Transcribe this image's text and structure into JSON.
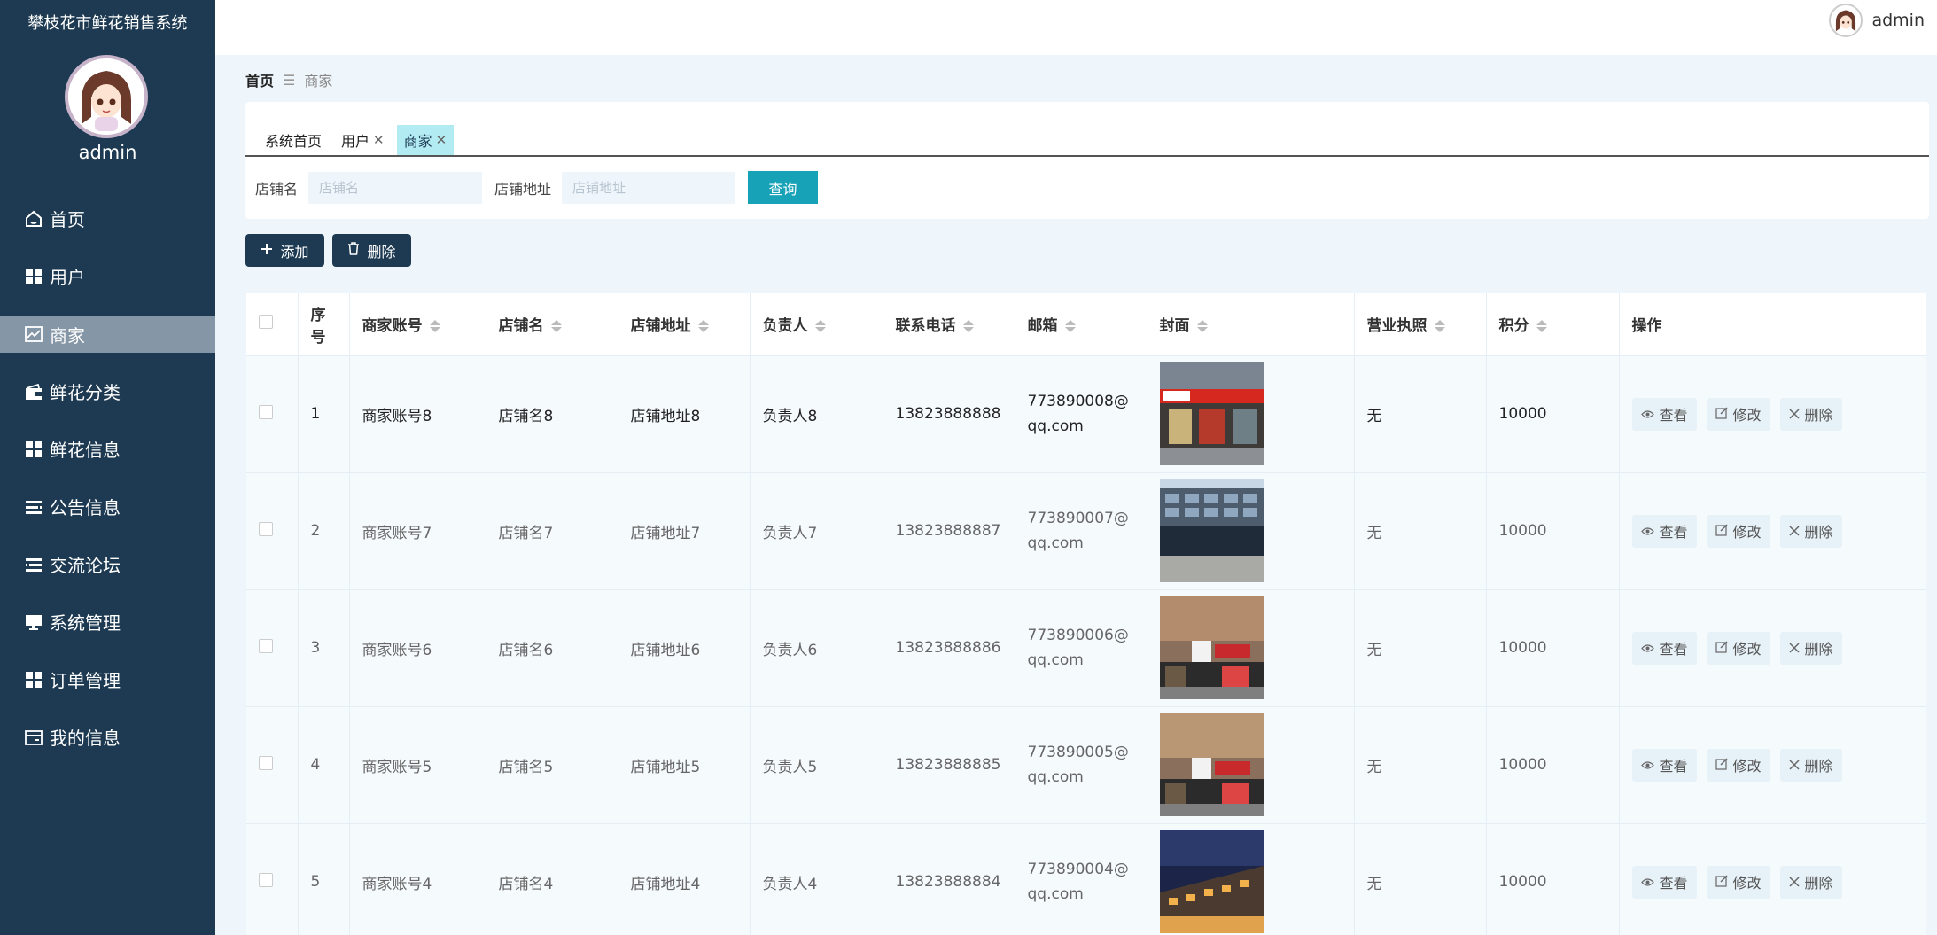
{
  "app": {
    "title": "攀枝花市鲜花销售系统",
    "admin_name": "admin"
  },
  "sidebar": {
    "items": [
      {
        "label": "首页",
        "icon": "home-icon"
      },
      {
        "label": "用户",
        "icon": "grid-icon"
      },
      {
        "label": "商家",
        "icon": "chart-icon",
        "active": true
      },
      {
        "label": "鲜花分类",
        "icon": "wallet-icon"
      },
      {
        "label": "鲜花信息",
        "icon": "grid-icon"
      },
      {
        "label": "公告信息",
        "icon": "list-icon"
      },
      {
        "label": "交流论坛",
        "icon": "list-icon"
      },
      {
        "label": "系统管理",
        "icon": "monitor-icon"
      },
      {
        "label": "订单管理",
        "icon": "grid-icon"
      },
      {
        "label": "我的信息",
        "icon": "card-icon"
      }
    ]
  },
  "header": {
    "user": "admin"
  },
  "breadcrumb": {
    "home": "首页",
    "current": "商家"
  },
  "tabs": [
    {
      "label": "系统首页"
    },
    {
      "label": "用户",
      "closable": true
    },
    {
      "label": "商家",
      "closable": true,
      "active": true
    }
  ],
  "search": {
    "shop_label": "店铺名",
    "shop_placeholder": "店铺名",
    "addr_label": "店铺地址",
    "addr_placeholder": "店铺地址",
    "query_label": "查询"
  },
  "actions": {
    "add": "添加",
    "delete": "删除"
  },
  "table": {
    "headers": [
      "序号",
      "商家账号",
      "店铺名",
      "店铺地址",
      "负责人",
      "联系电话",
      "邮箱",
      "封面",
      "营业执照",
      "积分",
      "操作"
    ],
    "op_labels": {
      "view": "查看",
      "edit": "修改",
      "delete": "删除"
    },
    "rows": [
      {
        "no": "1",
        "account": "商家账号8",
        "shop": "店铺名8",
        "address": "店铺地址8",
        "owner": "负责人8",
        "phone": "13823888888",
        "email": "773890008@qq.com",
        "license": "无",
        "points": "10000"
      },
      {
        "no": "2",
        "account": "商家账号7",
        "shop": "店铺名7",
        "address": "店铺地址7",
        "owner": "负责人7",
        "phone": "13823888887",
        "email": "773890007@qq.com",
        "license": "无",
        "points": "10000"
      },
      {
        "no": "3",
        "account": "商家账号6",
        "shop": "店铺名6",
        "address": "店铺地址6",
        "owner": "负责人6",
        "phone": "13823888886",
        "email": "773890006@qq.com",
        "license": "无",
        "points": "10000"
      },
      {
        "no": "4",
        "account": "商家账号5",
        "shop": "店铺名5",
        "address": "店铺地址5",
        "owner": "负责人5",
        "phone": "13823888885",
        "email": "773890005@qq.com",
        "license": "无",
        "points": "10000"
      },
      {
        "no": "5",
        "account": "商家账号4",
        "shop": "店铺名4",
        "address": "店铺地址4",
        "owner": "负责人4",
        "phone": "13823888884",
        "email": "773890004@qq.com",
        "license": "无",
        "points": "10000"
      }
    ]
  }
}
